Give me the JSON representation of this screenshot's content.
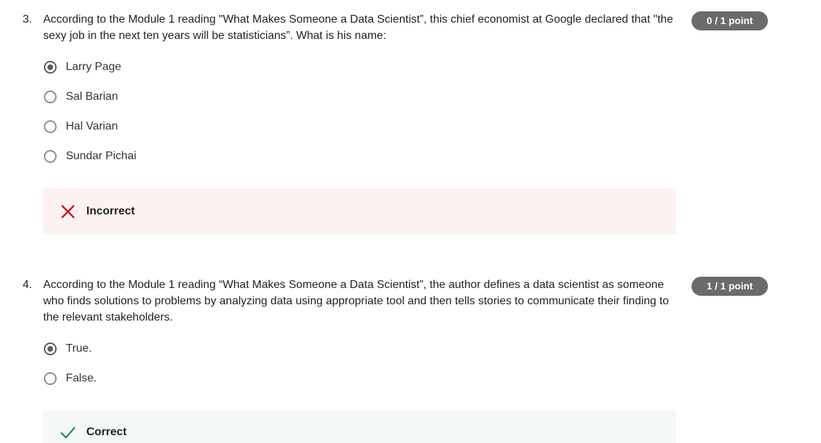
{
  "questions": [
    {
      "number": "3.",
      "text": "According to the Module 1 reading \"What Makes Someone a Data Scientist”, this chief economist at Google declared that \"the sexy job in the next ten years will be statisticians”. What is his name:",
      "points": "0 / 1 point",
      "options": [
        {
          "label": "Larry Page",
          "selected": true
        },
        {
          "label": "Sal Barian",
          "selected": false
        },
        {
          "label": "Hal Varian",
          "selected": false
        },
        {
          "label": "Sundar Pichai",
          "selected": false
        }
      ],
      "feedback": {
        "status": "incorrect",
        "label": "Incorrect",
        "icon": "x-icon",
        "color": "#c0161d",
        "background": "#fdf2f2"
      }
    },
    {
      "number": "4.",
      "text": "According to the Module 1 reading “What Makes Someone a Data Scientist”, the author defines a data scientist as someone who finds solutions to problems by analyzing data using appropriate tool and then tells stories to communicate their finding to the relevant stakeholders.",
      "points": "1 / 1 point",
      "options": [
        {
          "label": "True.",
          "selected": true
        },
        {
          "label": "False.",
          "selected": false
        }
      ],
      "feedback": {
        "status": "correct",
        "label": "Correct",
        "icon": "check-icon",
        "color": "#1f8354",
        "background": "#f4f9f7"
      }
    }
  ],
  "badge_color": "#6b6b6b"
}
